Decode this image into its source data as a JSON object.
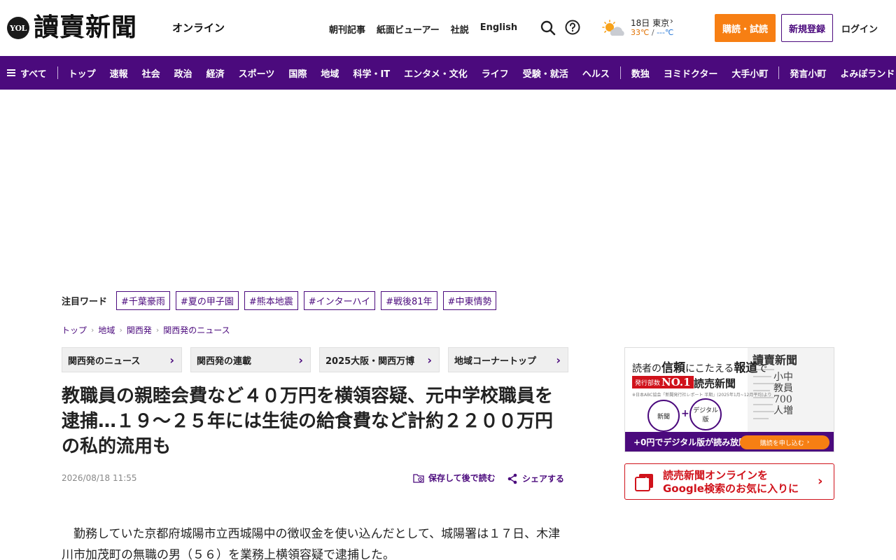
{
  "header": {
    "logo_badge": "YOL",
    "logo_title": "讀賣新聞",
    "logo_sub": "オンライン",
    "links": [
      "朝刊記事",
      "紙面ビューアー",
      "社説",
      "English"
    ],
    "weather": {
      "date_city": "18日 東京",
      "high": "33℃",
      "sep": " / ",
      "low": "---℃"
    },
    "subscribe_label": "購読・試読",
    "register_label": "新規登録",
    "login_label": "ログイン",
    "accent_color": "#4b0a7d",
    "cta_color": "#f77f13"
  },
  "nav": {
    "all_label": "すべて",
    "group1": [
      "トップ",
      "速報",
      "社会",
      "政治",
      "経済",
      "スポーツ",
      "国際",
      "地域",
      "科学・IT",
      "エンタメ・文化",
      "ライフ",
      "受験・就活",
      "ヘルス"
    ],
    "group2": [
      "数独",
      "ヨミドクター",
      "大手小町"
    ],
    "group3": [
      "発言小町",
      "よみぽランド"
    ]
  },
  "trend": {
    "label": "注目ワード",
    "tags": [
      "#千葉豪雨",
      "#夏の甲子園",
      "#熊本地震",
      "#インターハイ",
      "#戦後81年",
      "#中東情勢"
    ]
  },
  "breadcrumb": [
    "トップ",
    "地域",
    "関西発",
    "関西発のニュース"
  ],
  "section_buttons": [
    "関西発のニュース",
    "関西発の連載",
    "2025大阪・関西万博",
    "地域コーナートップ"
  ],
  "article": {
    "headline": "教職員の親睦会費など４０万円を横領容疑、元中学校職員を逮捕…１９～２５年には生徒の給食費など計約２２００万円の私的流用も",
    "timestamp": "2026/08/18 11:55",
    "save_label": "保存して後で読む",
    "share_label": "シェアする",
    "body": "　勤務していた京都府城陽市立西城陽中の徴収金を使い込んだとして、城陽署は１７日、木津川市加茂町の無職の男（５６）を業務上横領容疑で逮捕した。"
  },
  "promo": {
    "tagline_pre": "読者の",
    "tagline_strong": "信頼",
    "tagline_mid": "にこたえる",
    "tagline_strong2": "報道",
    "tagline_post": "で",
    "badge_pre": "発行部数",
    "badge_strong": "NO.1",
    "name": "読売新聞",
    "note": "※日本ABC協会「新聞発行社レポート 半期」(2025年1月~12月平均)より",
    "circle1": "新聞",
    "circle2": "デジタル版",
    "plus": "+",
    "masthead": "讀賣新聞",
    "paper_headline": "小中教員700人増",
    "bar_text": "+0円でデジタル版が読み放題！",
    "bar_button": "購読を申し込む"
  },
  "favorite": {
    "line1": "読売新聞オンラインを",
    "line2": "Google検索のお気に入りに"
  }
}
